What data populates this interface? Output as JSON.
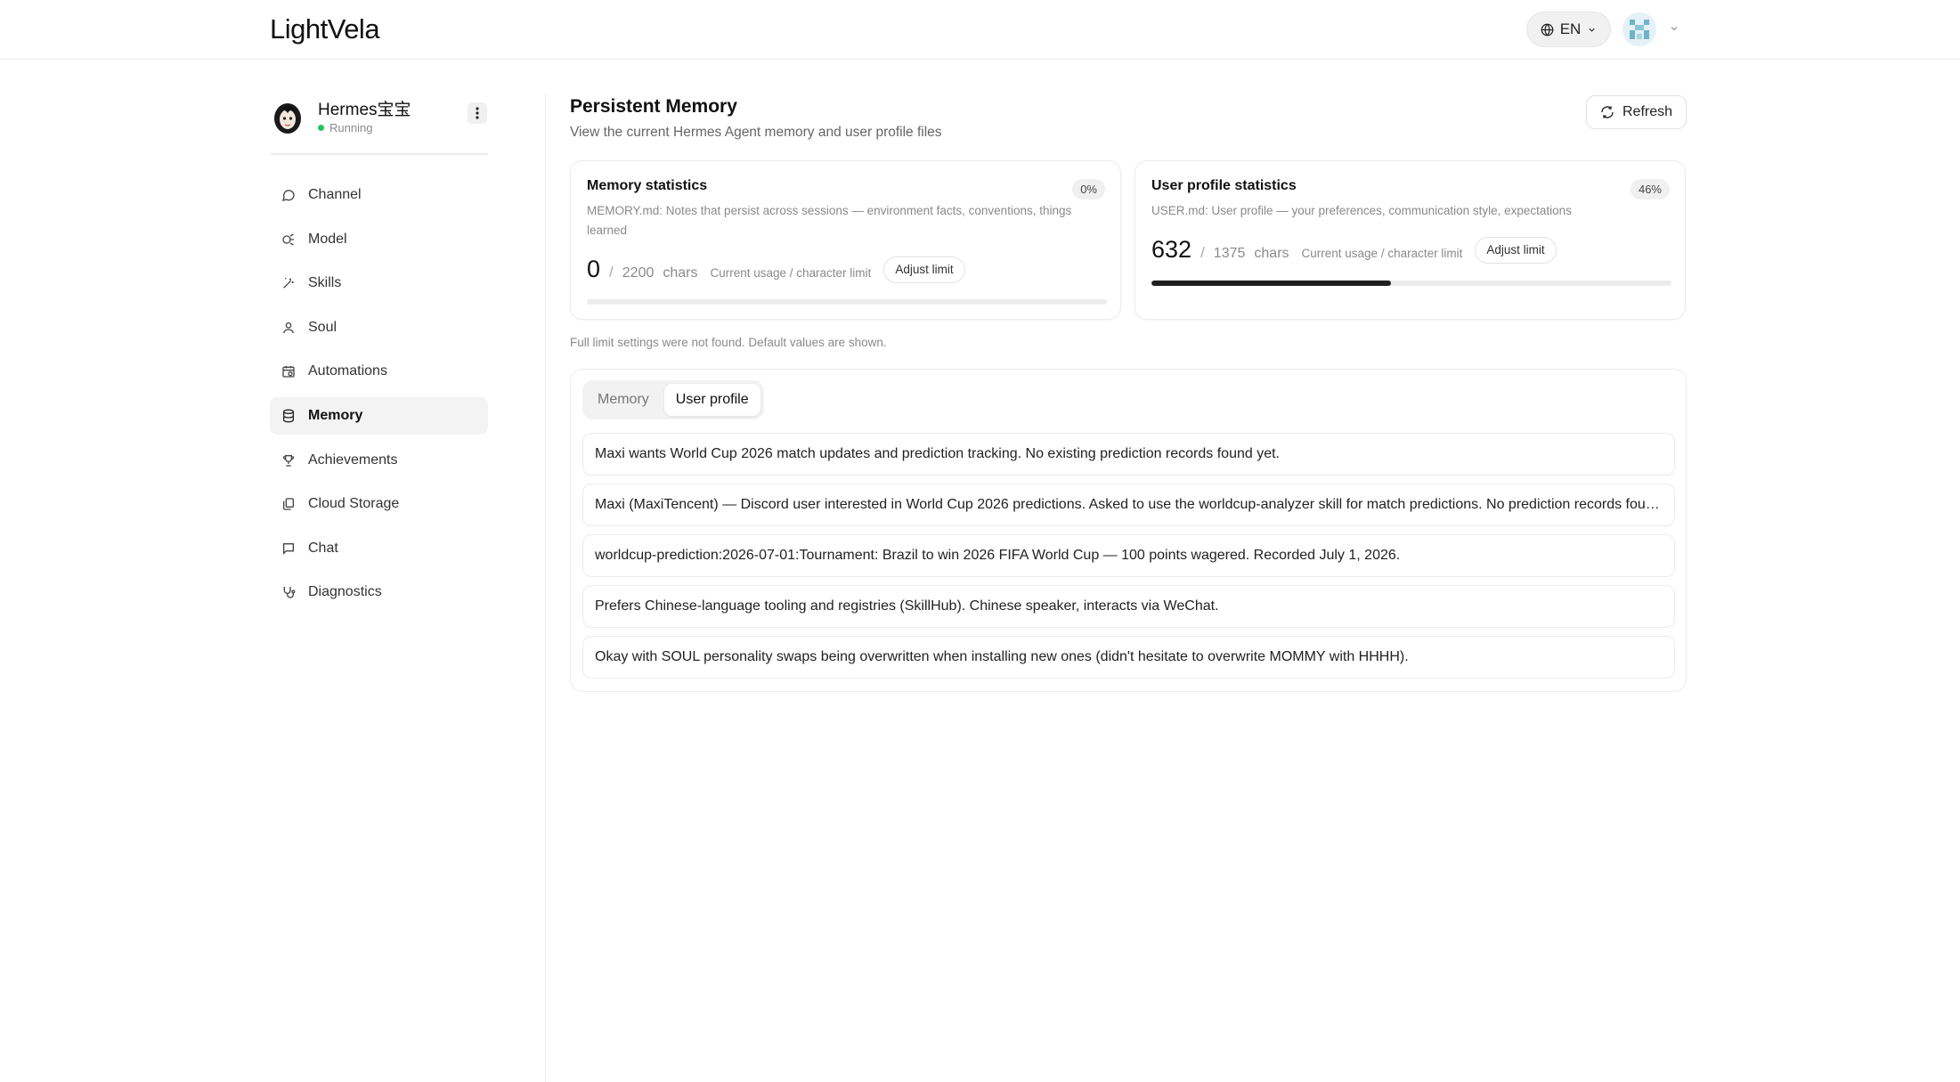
{
  "header": {
    "logo": "LightVela",
    "language": "EN"
  },
  "sidebar": {
    "agent_name": "Hermes宝宝",
    "agent_status": "Running",
    "items": [
      {
        "label": "Channel",
        "icon": "chat-bubble-icon"
      },
      {
        "label": "Model",
        "icon": "model-icon"
      },
      {
        "label": "Skills",
        "icon": "magic-wand-icon"
      },
      {
        "label": "Soul",
        "icon": "user-icon"
      },
      {
        "label": "Automations",
        "icon": "calendar-clock-icon"
      },
      {
        "label": "Memory",
        "icon": "database-icon",
        "active": true
      },
      {
        "label": "Achievements",
        "icon": "trophy-icon"
      },
      {
        "label": "Cloud Storage",
        "icon": "cloud-files-icon"
      },
      {
        "label": "Chat",
        "icon": "message-square-icon"
      },
      {
        "label": "Diagnostics",
        "icon": "stethoscope-icon"
      }
    ]
  },
  "main": {
    "title": "Persistent Memory",
    "subtitle": "View the current Hermes Agent memory and user profile files",
    "refresh_label": "Refresh",
    "memory_stats": {
      "title": "Memory statistics",
      "badge": "0%",
      "description": "MEMORY.md: Notes that persist across sessions — environment facts, conventions, things learned",
      "current": "0",
      "separator": "/",
      "limit": "2200",
      "unit": "chars",
      "note": "Current usage / character limit",
      "adjust_label": "Adjust limit",
      "progress": 0
    },
    "profile_stats": {
      "title": "User profile statistics",
      "badge": "46%",
      "description": "USER.md: User profile — your preferences, communication style, expectations",
      "current": "632",
      "separator": "/",
      "limit": "1375",
      "unit": "chars",
      "note": "Current usage / character limit",
      "adjust_label": "Adjust limit",
      "progress": 0.46
    },
    "hint": "Full limit settings were not found. Default values are shown.",
    "tabs": [
      {
        "label": "Memory",
        "active": false
      },
      {
        "label": "User profile",
        "active": true
      }
    ],
    "entries": [
      "Maxi wants World Cup 2026 match updates and prediction tracking. No existing prediction records found yet.",
      "Maxi (MaxiTencent) — Discord user interested in World Cup 2026 predictions. Asked to use the worldcup-analyzer skill for match predictions. No prediction records found yet.",
      "worldcup-prediction:2026-07-01:Tournament: Brazil to win 2026 FIFA World Cup — 100 points wagered. Recorded July 1, 2026.",
      "Prefers Chinese-language tooling and registries (SkillHub). Chinese speaker, interacts via WeChat.",
      "Okay with SOUL personality swaps being overwritten when installing new ones (didn't hesitate to overwrite MOMMY with HHHH)."
    ]
  },
  "colors": {
    "accent": "#1f1f1f",
    "status_running": "#22c55e",
    "border": "#ececec"
  }
}
